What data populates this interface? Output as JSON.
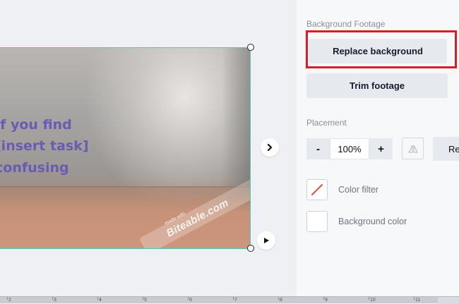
{
  "canvas": {
    "overlay_text": [
      "If you find",
      "[insert task]",
      "confusing"
    ],
    "watermark": {
      "small": "made with",
      "big": "Biteable.com"
    }
  },
  "panel": {
    "background_footage_label": "Background Footage",
    "replace_background_label": "Replace background",
    "trim_footage_label": "Trim footage",
    "placement_label": "Placement",
    "zoom_minus": "-",
    "zoom_value": "100%",
    "zoom_plus": "+",
    "reset_label": "Re",
    "color_filter_label": "Color filter",
    "background_color_label": "Background color"
  },
  "ruler": {
    "labels": [
      "2",
      "3",
      "4",
      "5",
      "6",
      "7",
      "8",
      "9",
      "10",
      "11"
    ]
  },
  "colors": {
    "accent_teal": "#4ec6c1",
    "highlight_red": "#e01a24",
    "overlay_text": "#6a5bb3",
    "color_filter_slash": "#e0533a"
  },
  "icons": {
    "next": "chevron-right-icon",
    "play": "play-icon",
    "flip": "flip-horizontal-icon",
    "color_filter": "no-filter-icon"
  }
}
